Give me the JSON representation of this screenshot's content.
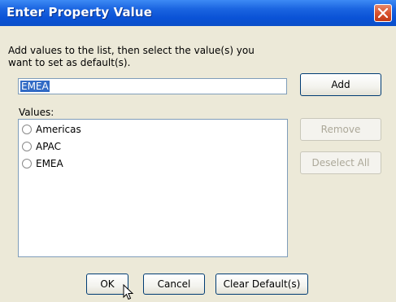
{
  "dialog": {
    "title": "Enter Property Value",
    "instruction": "Add values to the list, then select the value(s) you want to set as default(s).",
    "input_value": "EMEA",
    "values_label": "Values:",
    "values": [
      "Americas",
      "APAC",
      "EMEA"
    ],
    "buttons": {
      "add": "Add",
      "remove": "Remove",
      "deselect_all": "Deselect All",
      "ok": "OK",
      "cancel": "Cancel",
      "clear_defaults": "Clear Default(s)"
    }
  },
  "colors": {
    "titlebar": "#0a52d6",
    "dialog_bg": "#ece9d8",
    "selection": "#316ac5",
    "close_button": "#d9532e"
  }
}
